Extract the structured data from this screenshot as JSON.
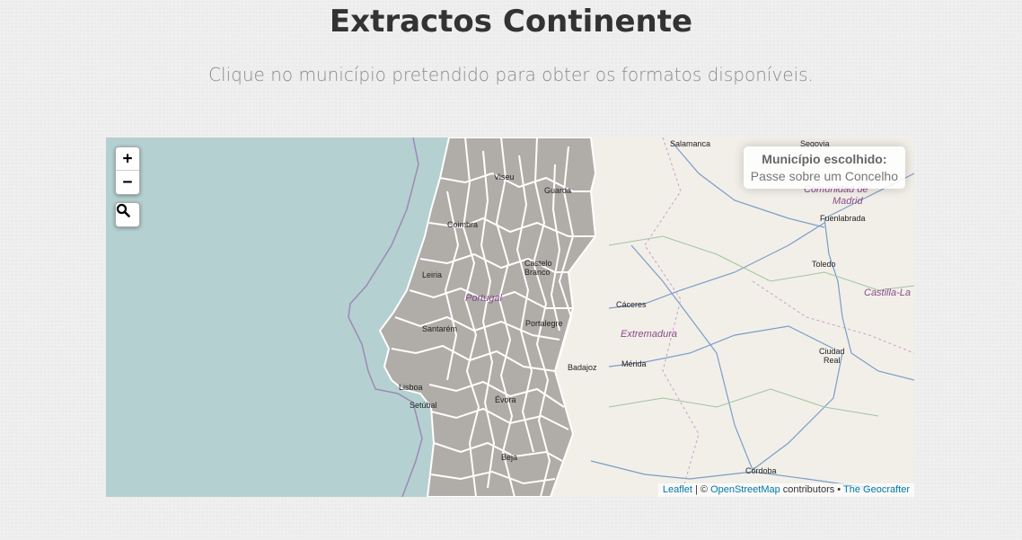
{
  "page": {
    "title": "Extractos Continente",
    "subtitle": "Clique no município pretendido para obter os formatos disponíveis."
  },
  "map": {
    "zoom_in_label": "+",
    "zoom_out_label": "−",
    "search_icon": "magnifier-icon",
    "info_panel": {
      "title": "Município escolhido:",
      "text": "Passe sobre um Concelho"
    },
    "attribution": {
      "leaflet": "Leaflet",
      "separator": " | © ",
      "osm": "OpenStreetMap",
      "contributors": " contributors • ",
      "geocrafter": "The Geocrafter"
    },
    "places": {
      "salamanca": "Salamanca",
      "segovia": "Segovia",
      "viseu": "Viseu",
      "guarda": "Guarda",
      "coimbra": "Coimbra",
      "castelo": "Castelo",
      "branco": "Branco",
      "leiria": "Leiria",
      "portugal": "Portugal",
      "portalegre": "Portalegre",
      "santarem": "Santarém",
      "caceres": "Cáceres",
      "extremadura": "Extremadura",
      "badajoz": "Badajoz",
      "merida": "Mérida",
      "lisboa": "Lisboa",
      "setubal": "Setúbal",
      "evora": "Évora",
      "beja": "Beja",
      "comunidad": "Comunidad de",
      "madrid": "Madrid",
      "fuenlabrada": "Fuenlabrada",
      "toledo": "Toledo",
      "castilla": "Castilla-La",
      "ciudad": "Ciudad",
      "real": "Real",
      "cordoba": "Córdoba"
    },
    "colors": {
      "sea": "#b5d0d0",
      "land": "#f2efe9",
      "portugal_fill": "#b0aca8",
      "boundary": "#ffffff",
      "region_label": "#8a4b8a",
      "link": "#0078a8"
    }
  }
}
